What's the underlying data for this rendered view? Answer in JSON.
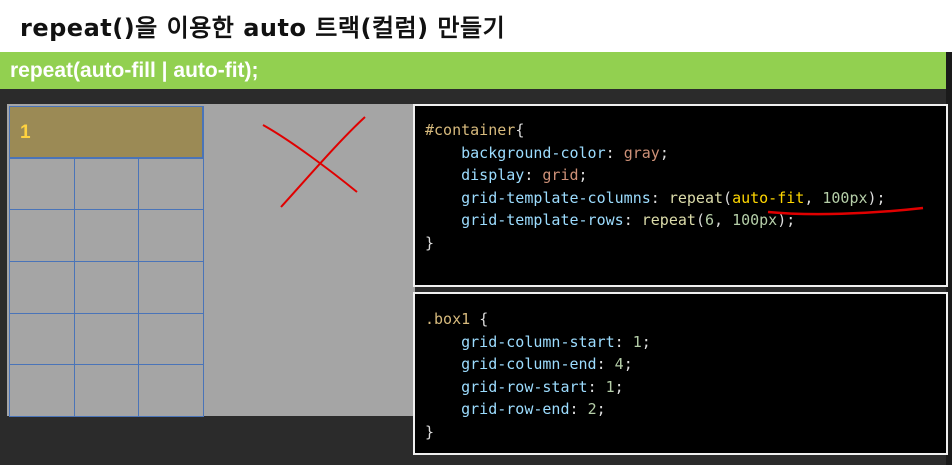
{
  "header": {
    "title": "repeat()을 이용한 auto 트랙(컬럼) 만들기"
  },
  "banner": {
    "subtitle": "repeat(auto-fill | auto-fit);"
  },
  "demo": {
    "box1_label": "1",
    "grid_columns": 3,
    "grid_rows": 6,
    "grid_line_color": "#4a74b8",
    "box1_color": "#9b8a55",
    "cross_mark_color": "#e00000"
  },
  "code_container": {
    "selector": "#container",
    "open": "{",
    "close": "}",
    "lines": [
      {
        "prop": "background-color",
        "value": "gray"
      },
      {
        "prop": "display",
        "value": "grid"
      },
      {
        "prop": "grid-template-columns",
        "fn": "repeat",
        "arg1": "auto-fit",
        "arg2": "100px"
      },
      {
        "prop": "grid-template-rows",
        "fn": "repeat",
        "arg1": "6",
        "arg2": "100px"
      }
    ]
  },
  "code_box1": {
    "selector": ".box1",
    "open": "{",
    "close": "}",
    "lines": [
      {
        "prop": "grid-column-start",
        "value": "1"
      },
      {
        "prop": "grid-column-end",
        "value": "4"
      },
      {
        "prop": "grid-row-start",
        "value": "1"
      },
      {
        "prop": "grid-row-end",
        "value": "2"
      }
    ]
  },
  "colors": {
    "banner": "#92d050",
    "code_bg": "#000000",
    "highlight": "#ffd700"
  }
}
